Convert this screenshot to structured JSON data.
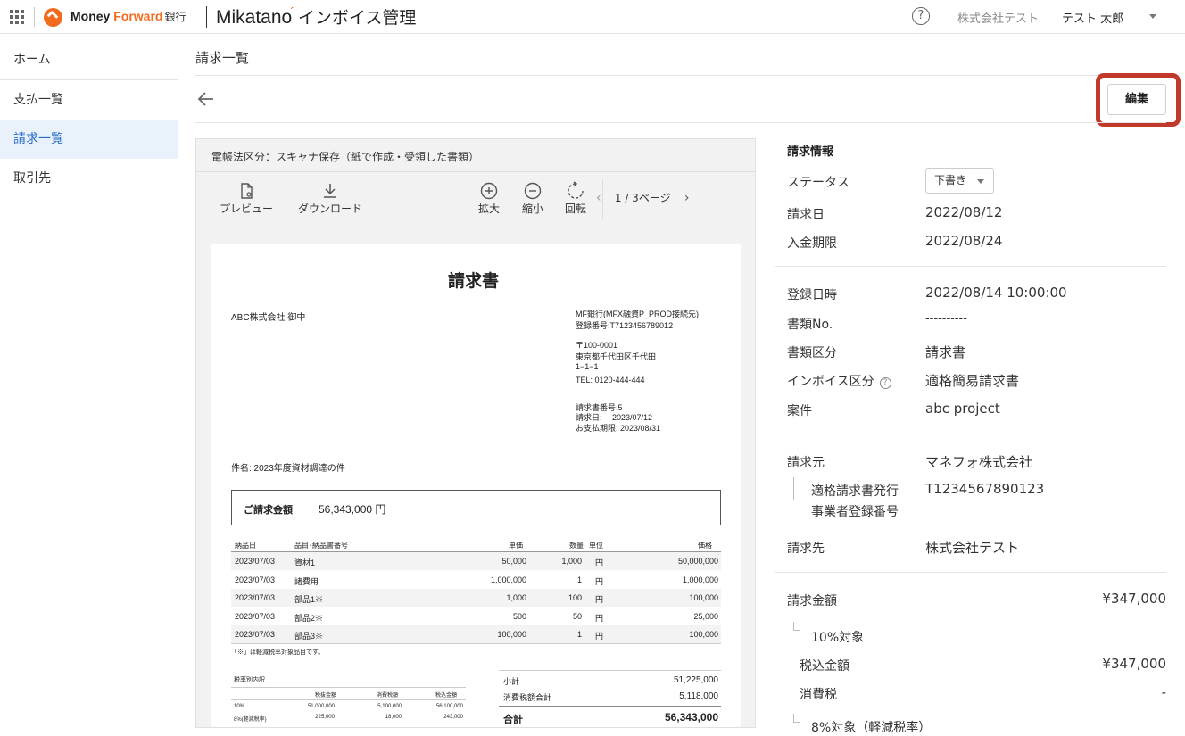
{
  "header": {
    "brand_money": "Money",
    "brand_forward": "Forward",
    "brand_bank": "銀行",
    "product_name": "Mikatano",
    "product_accent": "´",
    "product_sub": "インボイス管理",
    "help": "?",
    "company": "株式会社テスト",
    "user": "テスト 太郎"
  },
  "sidebar": {
    "items": [
      {
        "label": "ホーム"
      },
      {
        "label": "支払一覧"
      },
      {
        "label": "請求一覧"
      },
      {
        "label": "取引先"
      }
    ]
  },
  "main": {
    "page_title": "請求一覧",
    "edit_label": "編集"
  },
  "viewer": {
    "law_label": "電帳法区分：スキャナ保存（紙で作成・受領した書類）",
    "tools": {
      "preview": "プレビュー",
      "download": "ダウンロード",
      "zoom_in": "拡大",
      "zoom_out": "縮小",
      "rotate": "回転"
    },
    "pager": "1 / 3ページ",
    "document": {
      "title": "請求書",
      "addressee": "ABC株式会社 御中",
      "issuer_name": "MF銀行(MFX融資P_PROD接続先)",
      "issuer_reg": "登録番号:T7123456789012",
      "postal": "〒100-0001",
      "address": "東京都千代田区千代田",
      "address2": "1−1−1",
      "tel": "TEL: 0120-444-444",
      "invoice_no": "請求書番号:5",
      "invoice_date": "請求日:　  2023/07/12",
      "due_date": "お支払期限: 2023/08/31",
      "subject": "件名: 2023年度資材調達の件",
      "amount_label": "ご請求金額",
      "amount_value": "56,343,000 円",
      "table_headers": [
        "納品日",
        "品目･納品書番号",
        "単価",
        "数量",
        "単位",
        "価格"
      ],
      "rows": [
        [
          "2023/07/03",
          "資材1",
          "50,000",
          "1,000",
          "円",
          "50,000,000"
        ],
        [
          "2023/07/03",
          "諸費用",
          "1,000,000",
          "1",
          "円",
          "1,000,000"
        ],
        [
          "2023/07/03",
          "部品1※",
          "1,000",
          "100",
          "円",
          "100,000"
        ],
        [
          "2023/07/03",
          "部品2※",
          "500",
          "50",
          "円",
          "25,000"
        ],
        [
          "2023/07/03",
          "部品3※",
          "100,000",
          "1",
          "円",
          "100,000"
        ]
      ],
      "note": "「※」は軽減税率対象品目です。",
      "tax_title": "税率別内訳",
      "tax_headers": [
        "税抜金額",
        "消費税額",
        "税込金額"
      ],
      "tax_rows": [
        [
          "10%",
          "51,000,000",
          "5,100,000",
          "56,100,000"
        ],
        [
          "8%(軽減税率)",
          "225,000",
          "18,000",
          "243,000"
        ]
      ],
      "subtotal_label": "小計",
      "subtotal_value": "51,225,000",
      "tax_total_label": "消費税額合計",
      "tax_total_value": "5,118,000",
      "total_label": "合計",
      "total_value": "56,343,000"
    }
  },
  "info": {
    "section_title": "請求情報",
    "status_label": "ステータス",
    "status_value": "下書き",
    "invoice_date_label": "請求日",
    "invoice_date": "2022/08/12",
    "due_label": "入金期限",
    "due_date": "2022/08/24",
    "registered_label": "登録日時",
    "registered": "2022/08/14 10:00:00",
    "doc_no_label": "書類No.",
    "doc_no": "----------",
    "doc_type_label": "書類区分",
    "doc_type": "請求書",
    "invoice_type_label": "インボイス区分",
    "invoice_type": "適格簡易請求書",
    "project_label": "案件",
    "project": "abc project",
    "from_label": "請求元",
    "from": "マネフォ株式会社",
    "issuer_reg_label_1": "適格請求書発行",
    "issuer_reg_label_2": "事業者登録番号",
    "issuer_reg": "T1234567890123",
    "to_label": "請求先",
    "to": "株式会社テスト",
    "amount_label": "請求金額",
    "amount": "¥347,000",
    "ten_label": "10%対象",
    "tax_incl_label": "税込金額",
    "tax_incl": "¥347,000",
    "tax_label": "消費税",
    "tax": "-",
    "eight_label": "8%対象（軽減税率）"
  },
  "colors": {
    "accent": "#f26b1d",
    "active_nav": "#2a6dc7",
    "highlight": "#c0392b"
  }
}
